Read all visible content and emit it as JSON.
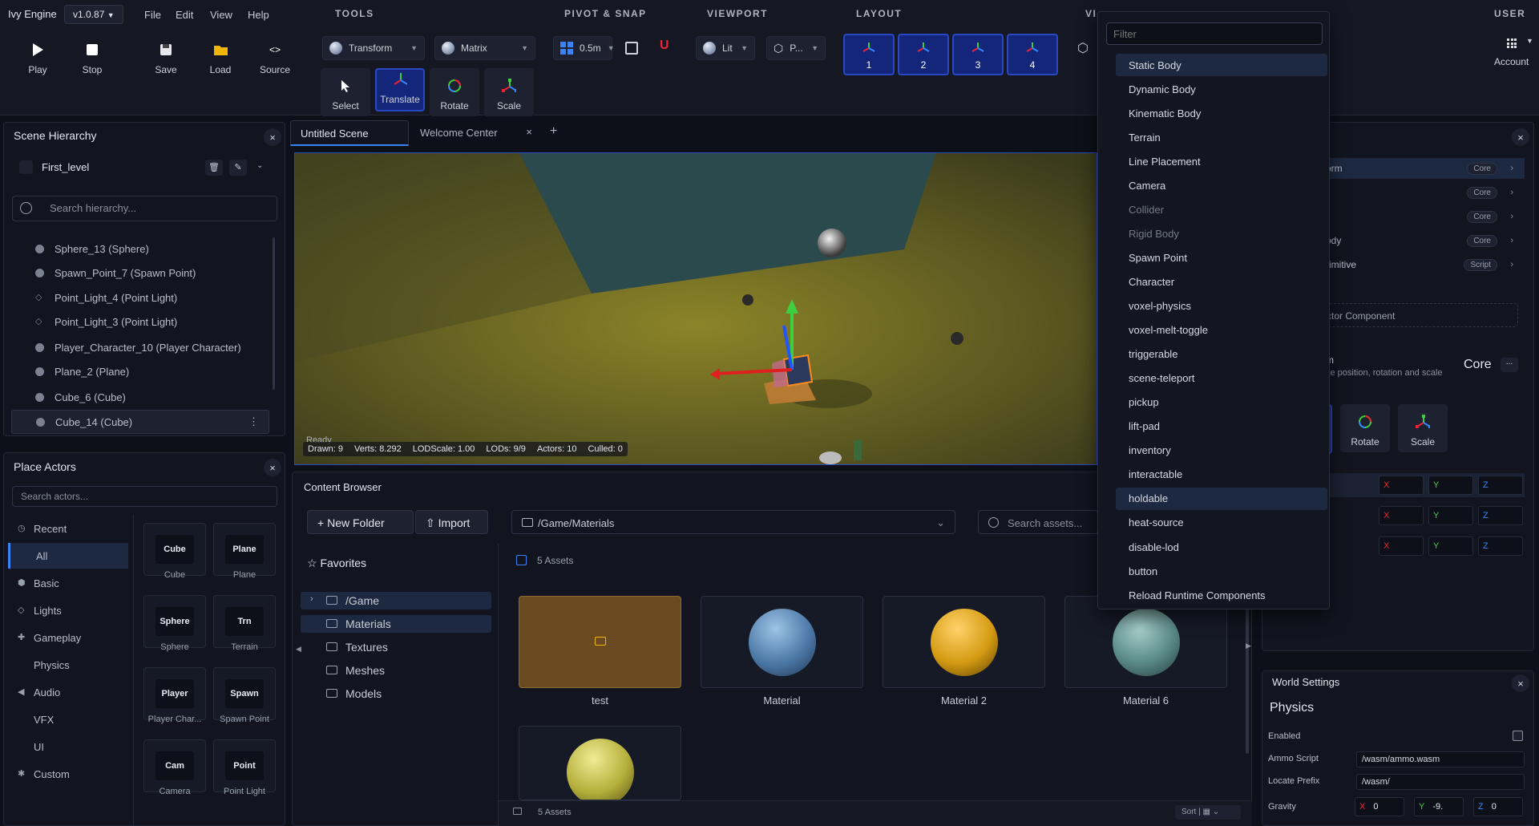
{
  "app": {
    "name": "Ivy Engine",
    "version": "v1.0.87"
  },
  "menu": {
    "file": "File",
    "edit": "Edit",
    "view": "View",
    "help": "Help"
  },
  "sections": {
    "tools": "TOOLS",
    "pivot_snap": "PIVOT & SNAP",
    "viewport": "VIEWPORT",
    "layout": "LAYOUT",
    "vi": "VI",
    "user": "USER"
  },
  "toolbar": {
    "play": "Play",
    "stop": "Stop",
    "save": "Save",
    "load": "Load",
    "source": "Source",
    "transform": "Transform",
    "matrix": "Matrix",
    "snap": "0.5m",
    "lit": "Lit",
    "p": "P...",
    "select": "Select",
    "translate": "Translate",
    "rotate": "Rotate",
    "scale": "Scale",
    "account": "Account"
  },
  "layout": [
    "1",
    "2",
    "3",
    "4"
  ],
  "hierarchy": {
    "title": "Scene Hierarchy",
    "level": "First_level",
    "search_placeholder": "Search hierarchy...",
    "items": [
      "Sphere_13 (Sphere)",
      "Spawn_Point_7 (Spawn Point)",
      "Point_Light_4 (Point Light)",
      "Point_Light_3 (Point Light)",
      "Player_Character_10 (Player Character)",
      "Plane_2 (Plane)",
      "Cube_6 (Cube)",
      "Cube_14 (Cube)"
    ]
  },
  "tabs": {
    "scene": "Untitled Scene",
    "welcome": "Welcome Center",
    "add": "+"
  },
  "viewport": {
    "ready": "Ready",
    "drawn": "Drawn: 9",
    "verts": "Verts: 8.292",
    "lodscale": "LODScale: 1.00",
    "lods": "LODs: 9/9",
    "actors": "Actors: 10",
    "culled": "Culled: 0"
  },
  "place_actors": {
    "title": "Place Actors",
    "search_placeholder": "Search actors...",
    "categories": [
      "Recent",
      "All",
      "Basic",
      "Lights",
      "Gameplay",
      "Physics",
      "Audio",
      "VFX",
      "UI",
      "Custom"
    ],
    "tiles": [
      {
        "icon": "Cube",
        "label": "Cube"
      },
      {
        "icon": "Plane",
        "label": "Plane"
      },
      {
        "icon": "Sphere",
        "label": "Sphere"
      },
      {
        "icon": "Trn",
        "label": "Terrain"
      },
      {
        "icon": "Player",
        "label": "Player Char..."
      },
      {
        "icon": "Spawn",
        "label": "Spawn Point"
      },
      {
        "icon": "Cam",
        "label": "Camera"
      },
      {
        "icon": "Point",
        "label": "Point Light"
      }
    ]
  },
  "content": {
    "title": "Content Browser",
    "new_folder": "New Folder",
    "import": "Import",
    "path": "/Game/Materials",
    "search_placeholder": "Search assets...",
    "favorites": "Favorites",
    "tree": [
      "/Game",
      "Materials",
      "Textures",
      "Meshes",
      "Models"
    ],
    "asset_count": "5 Assets",
    "footer_count": "5 Assets",
    "sort": "Sort",
    "assets": [
      "test",
      "Material",
      "Material 2",
      "Material 6"
    ]
  },
  "dropdown": {
    "filter_placeholder": "Filter",
    "items": [
      "Static Body",
      "Dynamic Body",
      "Kinematic Body",
      "Terrain",
      "Line Placement",
      "Camera",
      "Collider",
      "Rigid Body",
      "Spawn Point",
      "Character",
      "voxel-physics",
      "voxel-melt-toggle",
      "triggerable",
      "scene-teleport",
      "pickup",
      "lift-pad",
      "inventory",
      "interactable",
      "holdable",
      "heat-source",
      "disable-lod",
      "button",
      "Reload Runtime Components"
    ],
    "disabled": [
      "Collider",
      "Rigid Body"
    ],
    "highlighted": [
      "Static Body",
      "holdable"
    ]
  },
  "inspector": {
    "rows": [
      {
        "label": "orm",
        "badge": "Core"
      },
      {
        "label": "",
        "badge": "Core"
      },
      {
        "label": "r",
        "badge": "Core"
      },
      {
        "label": "ody",
        "badge": "Core"
      },
      {
        "label": "rimitive",
        "badge": "Script"
      }
    ],
    "add_component": "ctor Component",
    "comp_title": "m",
    "comp_desc": "ce position, rotation and scale",
    "comp_badge": "Core",
    "more": "...",
    "rotate": "Rotate",
    "scale": "Scale",
    "axes": {
      "x": "X",
      "y": "Y",
      "z": "Z"
    }
  },
  "world": {
    "title": "World Settings",
    "section": "Physics",
    "enabled": "Enabled",
    "ammo_label": "Ammo Script",
    "ammo_value": "/wasm/ammo.wasm",
    "locate_label": "Locate Prefix",
    "locate_value": "/wasm/",
    "gravity_label": "Gravity",
    "gx": "0",
    "gy": "-9.",
    "gz": "0"
  }
}
